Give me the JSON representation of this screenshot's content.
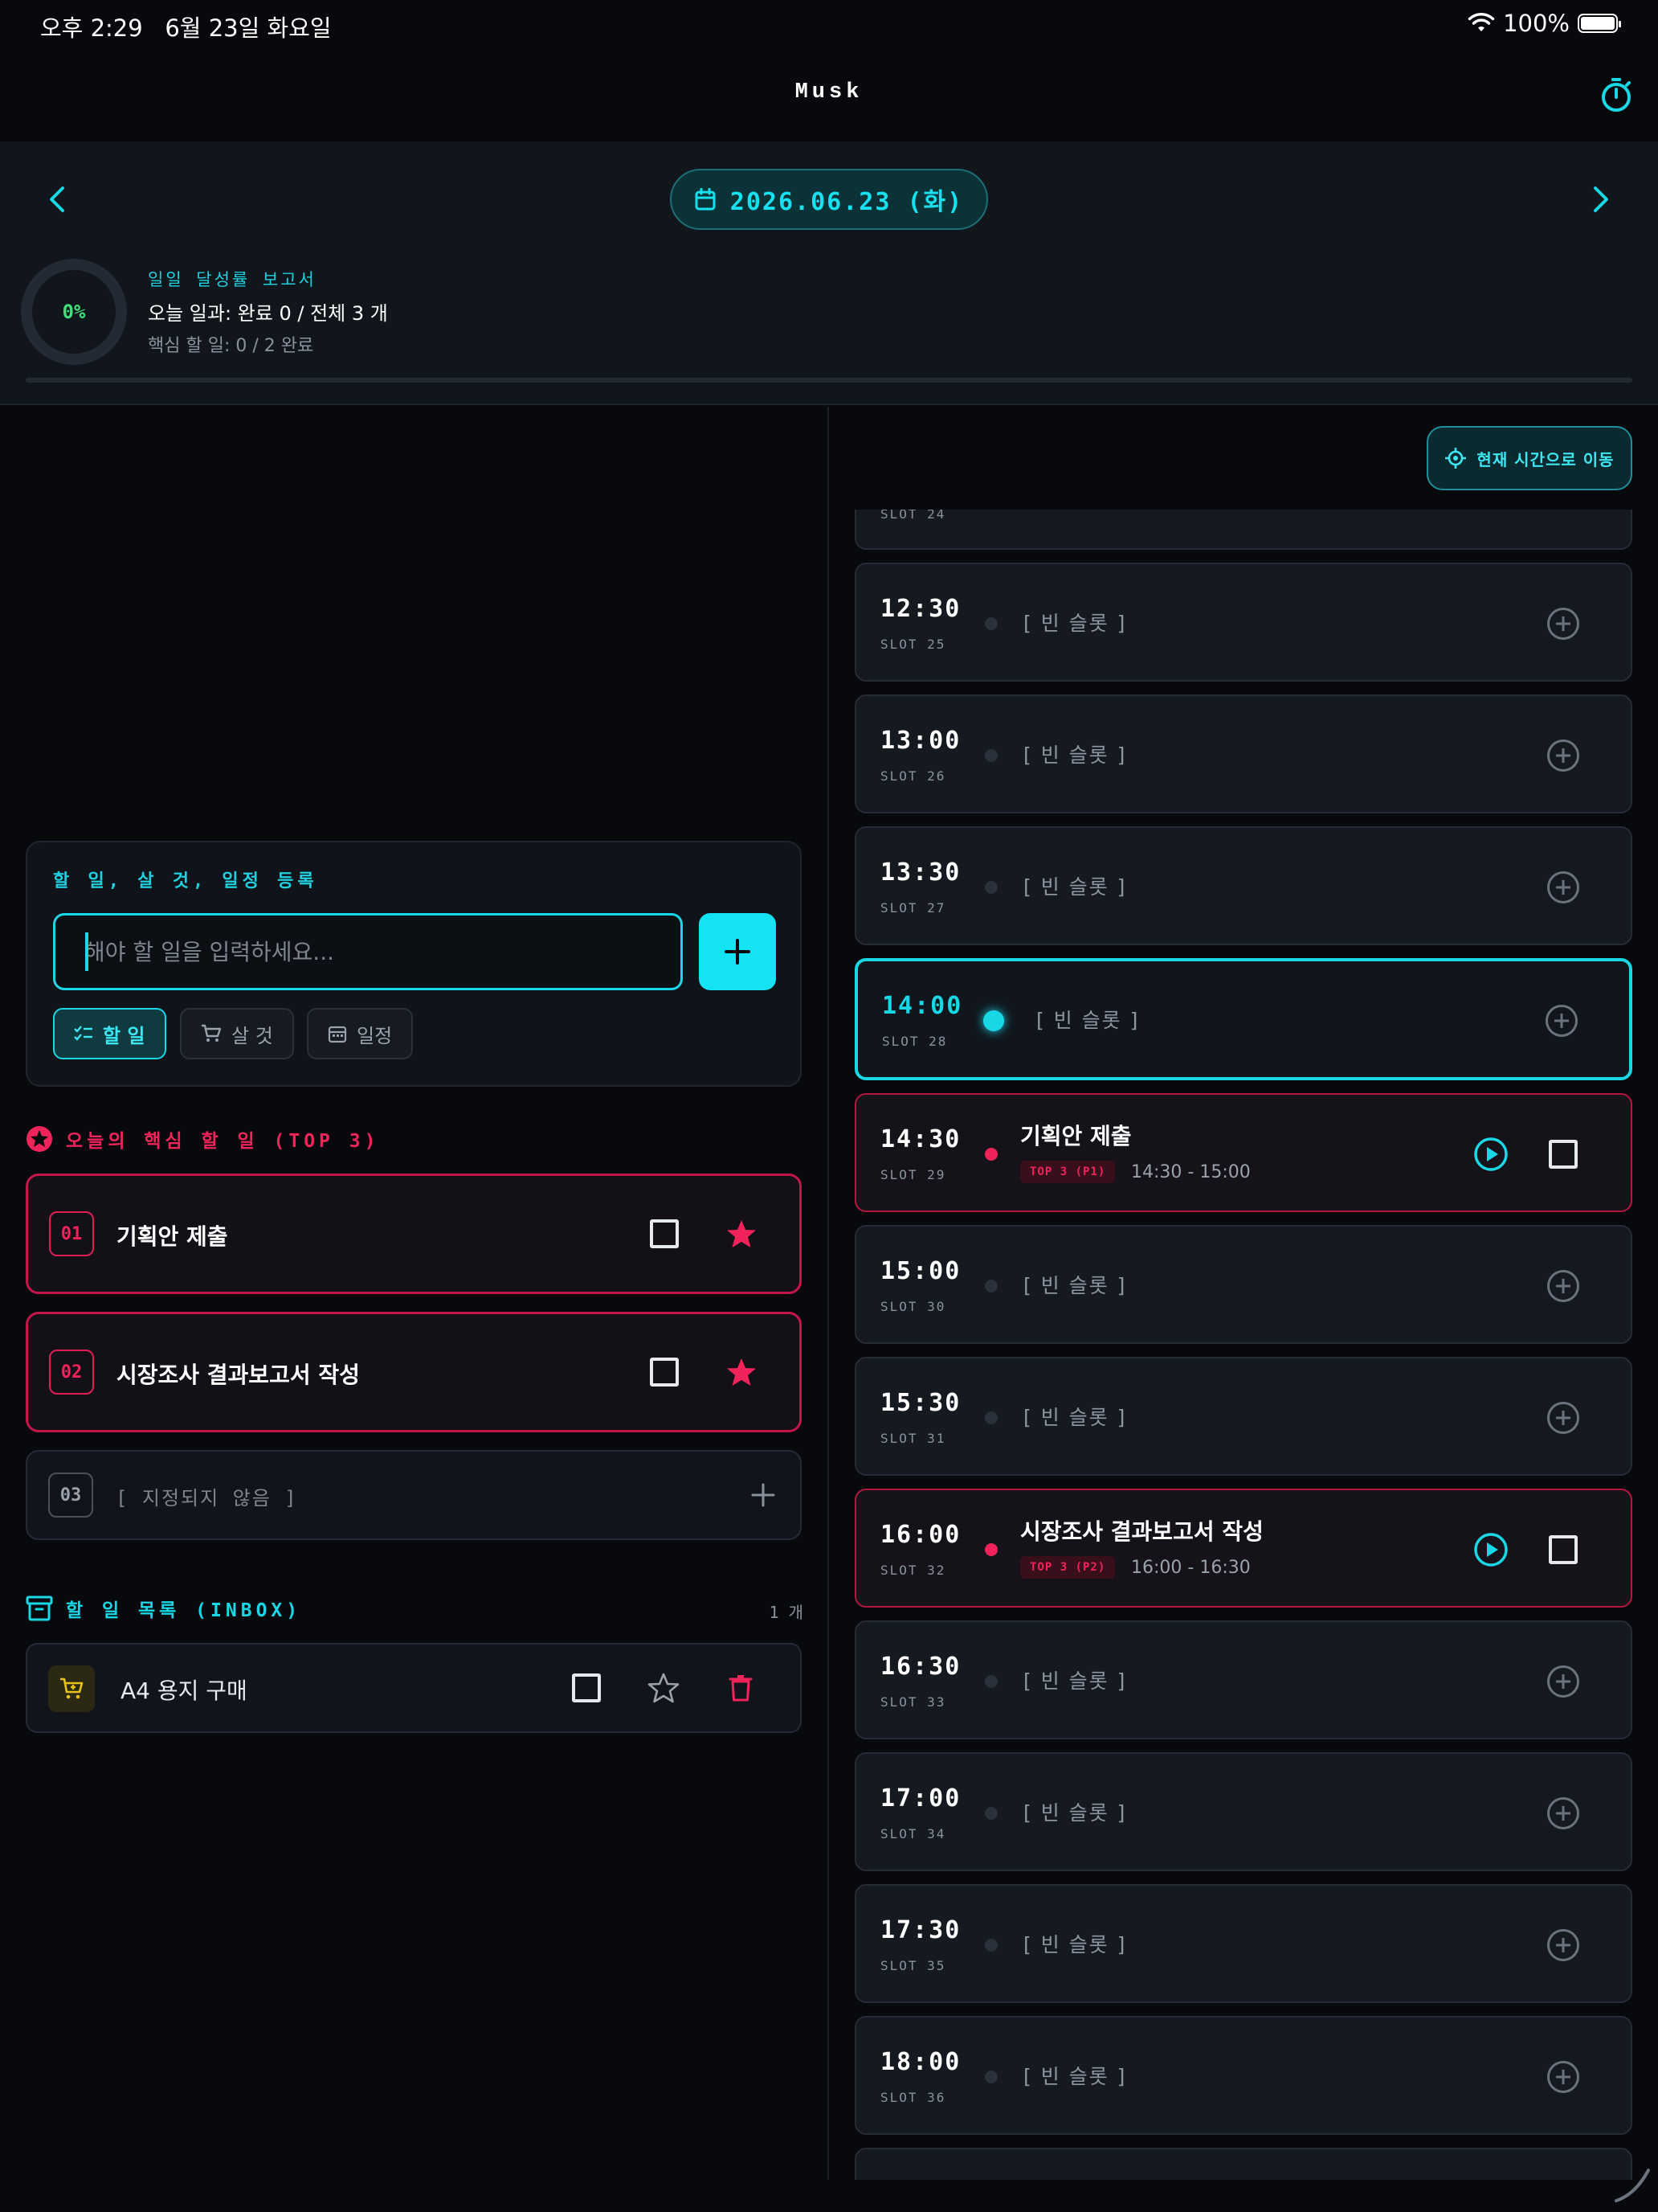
{
  "status_bar": {
    "time": "오후 2:29",
    "date": "6월 23일 화요일",
    "battery": "100%"
  },
  "header": {
    "title": "Musk",
    "timer_icon": "stopwatch-icon"
  },
  "date_nav": {
    "date_label": "2026.06.23 (화)",
    "prev_icon": "chevron-left-icon",
    "next_icon": "chevron-right-icon"
  },
  "report": {
    "percent": "0%",
    "title": "일일 달성률 보고서",
    "summary": "오늘 일과: 완료 0 / 전체 3 개",
    "core_summary": "핵심 할 일: 0 / 2 완료",
    "progress": 0
  },
  "input_card": {
    "title": "할 일, 살 것, 일정 등록",
    "placeholder": "해야 할 일을 입력하세요...",
    "value": "",
    "types": [
      {
        "label": "할 일",
        "icon": "checklist-icon",
        "active": true
      },
      {
        "label": "살 것",
        "icon": "cart-icon",
        "active": false
      },
      {
        "label": "일정",
        "icon": "calendar-icon",
        "active": false
      }
    ]
  },
  "top3": {
    "title": "오늘의 핵심 할 일 (TOP 3)",
    "items": [
      {
        "rank": "01",
        "label": "기획안 제출",
        "done": false,
        "starred": true
      },
      {
        "rank": "02",
        "label": "시장조사 결과보고서 작성",
        "done": false,
        "starred": true
      },
      {
        "rank": "03",
        "label": "[ 지정되지 않음 ]",
        "empty": true
      }
    ]
  },
  "inbox": {
    "title": "할 일 목록 (INBOX)",
    "count": "1 개",
    "items": [
      {
        "label": "A4 용지 구매",
        "type": "cart-icon",
        "done": false,
        "starred": false
      }
    ]
  },
  "timeline": {
    "goto_now_label": "현재 시간으로 이동",
    "partial_top_slot_id": "SLOT 24",
    "slots": [
      {
        "time": "12:30",
        "id": "SLOT 25",
        "label": "[ 빈 슬롯 ]",
        "state": "empty"
      },
      {
        "time": "13:00",
        "id": "SLOT 26",
        "label": "[ 빈 슬롯 ]",
        "state": "empty"
      },
      {
        "time": "13:30",
        "id": "SLOT 27",
        "label": "[ 빈 슬롯 ]",
        "state": "empty"
      },
      {
        "time": "14:00",
        "id": "SLOT 28",
        "label": "[ 빈 슬롯 ]",
        "state": "current"
      },
      {
        "time": "14:30",
        "id": "SLOT 29",
        "label": "기획안 제출",
        "badge": "TOP 3 (P1)",
        "range": "14:30 - 15:00",
        "state": "task"
      },
      {
        "time": "15:00",
        "id": "SLOT 30",
        "label": "[ 빈 슬롯 ]",
        "state": "empty"
      },
      {
        "time": "15:30",
        "id": "SLOT 31",
        "label": "[ 빈 슬롯 ]",
        "state": "empty"
      },
      {
        "time": "16:00",
        "id": "SLOT 32",
        "label": "시장조사 결과보고서 작성",
        "badge": "TOP 3 (P2)",
        "range": "16:00 - 16:30",
        "state": "task"
      },
      {
        "time": "16:30",
        "id": "SLOT 33",
        "label": "[ 빈 슬롯 ]",
        "state": "empty"
      },
      {
        "time": "17:00",
        "id": "SLOT 34",
        "label": "[ 빈 슬롯 ]",
        "state": "empty"
      },
      {
        "time": "17:30",
        "id": "SLOT 35",
        "label": "[ 빈 슬롯 ]",
        "state": "empty"
      },
      {
        "time": "18:00",
        "id": "SLOT 36",
        "label": "[ 빈 슬롯 ]",
        "state": "empty"
      }
    ]
  },
  "colors": {
    "accent": "#1ad7e6",
    "priority": "#f0245a",
    "success": "#3de07a",
    "background": "#07090d"
  }
}
